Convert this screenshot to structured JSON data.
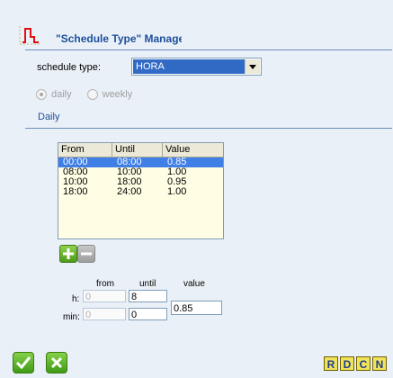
{
  "title": "\"Schedule Type\" Manage",
  "schedule_type": {
    "label": "schedule type:",
    "selected": "HORA"
  },
  "frequency": {
    "daily_label": "daily",
    "weekly_label": "weekly",
    "selected": "daily"
  },
  "section_title": "Daily",
  "table": {
    "headers": [
      "From",
      "Until",
      "Value"
    ],
    "rows": [
      {
        "from": "00:00",
        "until": "08:00",
        "value": "0.85",
        "selected": true
      },
      {
        "from": "08:00",
        "until": "10:00",
        "value": "1.00"
      },
      {
        "from": "10:00",
        "until": "18:00",
        "value": "0.95"
      },
      {
        "from": "18:00",
        "until": "24:00",
        "value": "1.00"
      }
    ]
  },
  "editor": {
    "from_label": "from",
    "until_label": "until",
    "value_label": "value",
    "h_label": "h:",
    "min_label": "min:",
    "from_h": "0",
    "from_min": "0",
    "until_h": "8",
    "until_min": "0",
    "value": "0.85"
  },
  "footer_letters": [
    "R",
    "D",
    "C",
    "N"
  ],
  "colors": {
    "accent": "#1c4f9c",
    "selection": "#3f7fe6",
    "ok_green": "#4e9a1a"
  }
}
